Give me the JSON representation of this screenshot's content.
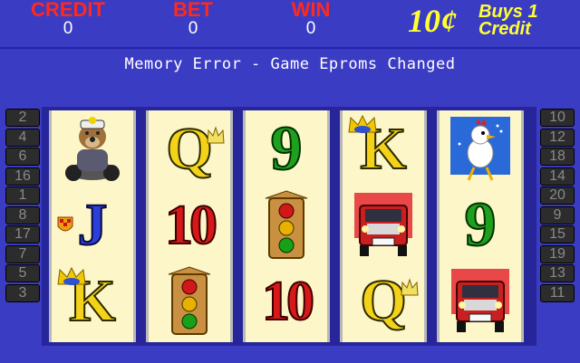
{
  "meters": {
    "credit": {
      "label": "CREDIT",
      "value": "0"
    },
    "bet": {
      "label": "BET",
      "value": "0"
    },
    "win": {
      "label": "WIN",
      "value": "0"
    }
  },
  "denomination": {
    "amount": "10¢",
    "line1": "Buys 1",
    "line2": "Credit"
  },
  "message": "Memory Error - Game Eproms Changed",
  "left_lines": [
    "2",
    "4",
    "6",
    "16",
    "1",
    "8",
    "17",
    "7",
    "5",
    "3"
  ],
  "right_lines": [
    "10",
    "12",
    "18",
    "14",
    "20",
    "9",
    "15",
    "19",
    "13",
    "11"
  ],
  "reels": [
    [
      "biker-dog-symbol",
      "J",
      "K"
    ],
    [
      "Q",
      "10",
      "traffic-light-symbol"
    ],
    [
      "9",
      "traffic-light-symbol",
      "10"
    ],
    [
      "K",
      "truck-symbol",
      "Q"
    ],
    [
      "chicken-symbol",
      "9",
      "truck-symbol"
    ]
  ],
  "colors": {
    "background": "#3b3cc4",
    "meter_label": "#ff2a1a",
    "denom": "#ffff33",
    "reel_bg": "#fdf6c8"
  }
}
